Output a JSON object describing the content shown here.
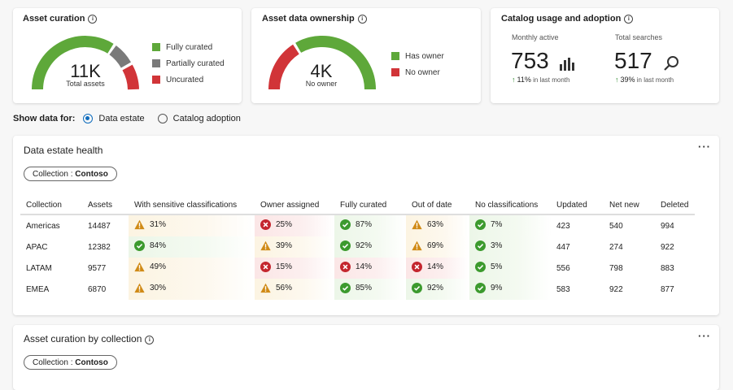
{
  "asset_curation": {
    "title": "Asset curation",
    "total": "11K",
    "total_label": "Total assets",
    "legend": [
      {
        "label": "Fully curated",
        "color": "#5ea83a"
      },
      {
        "label": "Partially curated",
        "color": "#7a7a7a"
      },
      {
        "label": "Uncurated",
        "color": "#d13438"
      }
    ]
  },
  "asset_ownership": {
    "title": "Asset data ownership",
    "total": "4K",
    "total_label": "No owner",
    "legend": [
      {
        "label": "Has owner",
        "color": "#5ea83a"
      },
      {
        "label": "No owner",
        "color": "#d13438"
      }
    ]
  },
  "catalog_usage": {
    "title": "Catalog usage and adoption",
    "monthly_active": {
      "label": "Monthly active",
      "value": "753",
      "delta": "11%",
      "delta_text": "in last month",
      "icon": "bar-chart-icon"
    },
    "total_searches": {
      "label": "Total searches",
      "value": "517",
      "delta": "39%",
      "delta_text": "in last month",
      "icon": "search-icon"
    }
  },
  "show_data_for": {
    "label": "Show data for:",
    "options": [
      "Data estate",
      "Catalog adoption"
    ],
    "selected": "Data estate"
  },
  "data_estate_health": {
    "title": "Data estate health",
    "collection_filter_label": "Collection :",
    "collection_filter_value": "Contoso",
    "columns": [
      "Collection",
      "Assets",
      "With sensitive classifications",
      "Owner assigned",
      "Fully curated",
      "Out of date",
      "No classifications",
      "Updated",
      "Net new",
      "Deleted"
    ],
    "rows": [
      {
        "collection": "Americas",
        "assets": "14487",
        "sensitive": {
          "value": "31%",
          "status": "warn"
        },
        "owner": {
          "value": "25%",
          "status": "bad"
        },
        "curated": {
          "value": "87%",
          "status": "good"
        },
        "outdated": {
          "value": "63%",
          "status": "warn"
        },
        "noclass": {
          "value": "7%",
          "status": "good"
        },
        "updated": "423",
        "netnew": "540",
        "deleted": "994"
      },
      {
        "collection": "APAC",
        "assets": "12382",
        "sensitive": {
          "value": "84%",
          "status": "good"
        },
        "owner": {
          "value": "39%",
          "status": "warn"
        },
        "curated": {
          "value": "92%",
          "status": "good"
        },
        "outdated": {
          "value": "69%",
          "status": "warn"
        },
        "noclass": {
          "value": "3%",
          "status": "good"
        },
        "updated": "447",
        "netnew": "274",
        "deleted": "922"
      },
      {
        "collection": "LATAM",
        "assets": "9577",
        "sensitive": {
          "value": "49%",
          "status": "warn"
        },
        "owner": {
          "value": "15%",
          "status": "bad"
        },
        "curated": {
          "value": "14%",
          "status": "bad"
        },
        "outdated": {
          "value": "14%",
          "status": "bad"
        },
        "noclass": {
          "value": "5%",
          "status": "good"
        },
        "updated": "556",
        "netnew": "798",
        "deleted": "883"
      },
      {
        "collection": "EMEA",
        "assets": "6870",
        "sensitive": {
          "value": "30%",
          "status": "warn"
        },
        "owner": {
          "value": "56%",
          "status": "warn"
        },
        "curated": {
          "value": "85%",
          "status": "good"
        },
        "outdated": {
          "value": "92%",
          "status": "good"
        },
        "noclass": {
          "value": "9%",
          "status": "good"
        },
        "updated": "583",
        "netnew": "922",
        "deleted": "877"
      }
    ]
  },
  "asset_curation_by_collection": {
    "title": "Asset curation by collection",
    "collection_filter_label": "Collection :",
    "collection_filter_value": "Contoso"
  },
  "status_colors": {
    "good": "#3c9a2e",
    "warn": "#d08a16",
    "bad": "#c4262e"
  }
}
